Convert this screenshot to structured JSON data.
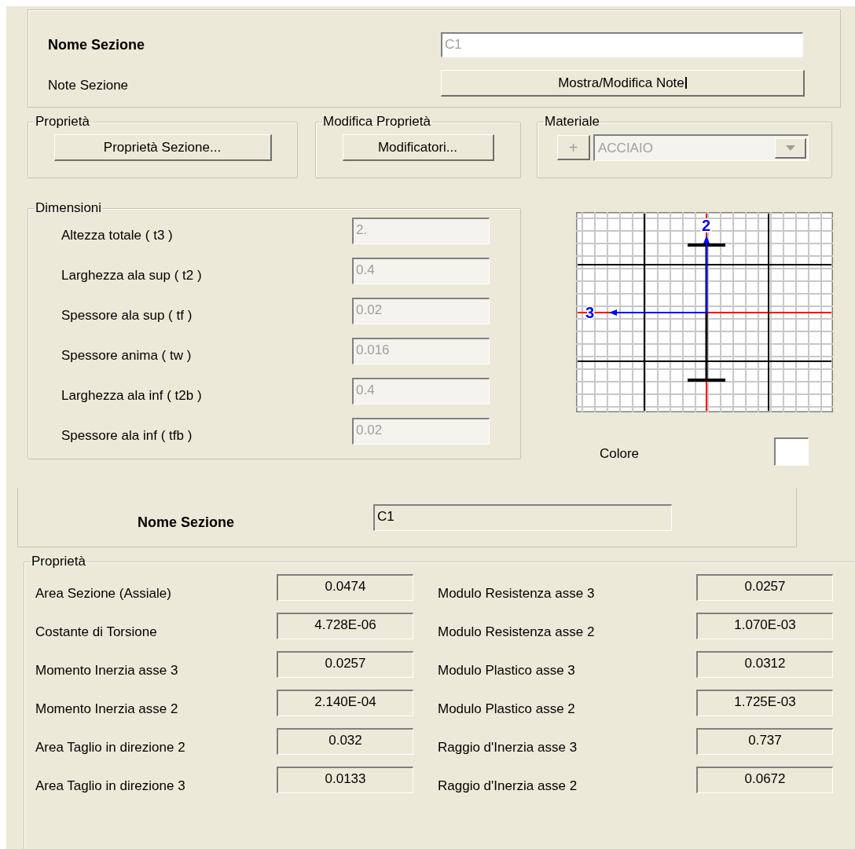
{
  "section_name": {
    "label": "Nome Sezione",
    "value": "C1",
    "disabled": true
  },
  "section_notes": {
    "label": "Note Sezione",
    "button": "Mostra/Modifica Note",
    "focused": true
  },
  "property_groups": [
    {
      "title": "Proprietà",
      "button": "Proprietà Sezione..."
    },
    {
      "title": "Modifica Proprietà",
      "button": "Modificatori..."
    }
  ],
  "material": {
    "title": "Materiale",
    "add_button": "+",
    "value": "ACCIAIO",
    "disabled": true
  },
  "dimensions": {
    "title": "Dimensioni",
    "fields": [
      {
        "label": "Altezza totale ( t3 )",
        "value": "2.",
        "disabled": true
      },
      {
        "label": "Larghezza ala sup ( t2 )",
        "value": "0.4",
        "disabled": true
      },
      {
        "label": "Spessore ala sup ( tf )",
        "value": "0.02",
        "disabled": true
      },
      {
        "label": "Spessore anima ( tw )",
        "value": "0.016",
        "disabled": true
      },
      {
        "label": "Larghezza ala inf ( t2b )",
        "value": "0.4",
        "disabled": true
      },
      {
        "label": "Spessore ala inf ( tfb )",
        "value": "0.02",
        "disabled": true
      }
    ]
  },
  "section_diagram": {
    "axis_labels": [
      "2",
      "3"
    ]
  },
  "color": {
    "label": "Colore",
    "color": "#ffffff"
  },
  "summary": {
    "label": "Nome Sezione",
    "value": "C1"
  },
  "properties": {
    "title": "Proprietà",
    "left": [
      {
        "label": "Area Sezione (Assiale)",
        "value": "0.0474"
      },
      {
        "label": "Costante di Torsione",
        "value": "4.728E-06"
      },
      {
        "label": "Momento Inerzia asse 3",
        "value": "0.0257"
      },
      {
        "label": "Momento Inerzia asse 2",
        "value": "2.140E-04"
      },
      {
        "label": "Area Taglio in direzione 2",
        "value": "0.032"
      },
      {
        "label": "Area Taglio in direzione 3",
        "value": "0.0133"
      }
    ],
    "right": [
      {
        "label": "Modulo Resistenza asse 3",
        "value": "0.0257"
      },
      {
        "label": "Modulo Resistenza asse 2",
        "value": "1.070E-03"
      },
      {
        "label": "Modulo Plastico asse 3",
        "value": "0.0312"
      },
      {
        "label": "Modulo Plastico asse 2",
        "value": "1.725E-03"
      },
      {
        "label": "Raggio d'Inerzia asse 3",
        "value": "0.737"
      },
      {
        "label": "Raggio d'Inerzia asse 2",
        "value": "0.0672"
      }
    ]
  }
}
